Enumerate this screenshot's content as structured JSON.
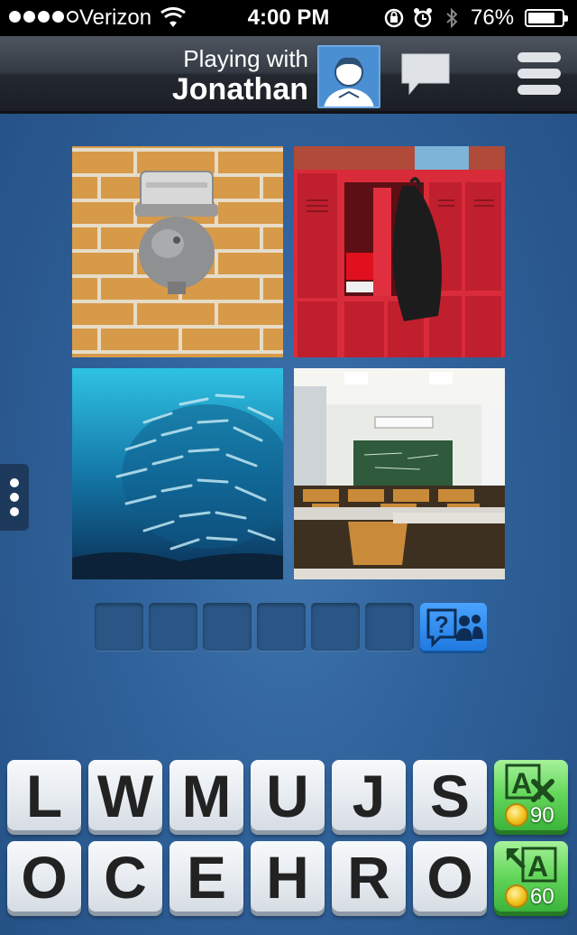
{
  "status_bar": {
    "carrier": "Verizon",
    "time": "4:00 PM",
    "battery_percent": "76%",
    "battery_level": 0.76,
    "signal_bars": 4,
    "icons": [
      "wifi-icon",
      "rotation-lock-icon",
      "alarm-icon",
      "bluetooth-icon",
      "battery-icon"
    ]
  },
  "header": {
    "playing_with_label": "Playing with",
    "opponent_name": "Jonathan",
    "avatar_icon": "user-avatar-icon",
    "chat_icon": "chat-bubble-icon",
    "menu_icon": "hamburger-menu-icon"
  },
  "puzzle": {
    "pictures": [
      "bell-on-brick-wall",
      "red-school-lockers-with-backpack",
      "school-of-fish-underwater",
      "classroom-with-desks"
    ],
    "answer_length": 6,
    "answer_letters": [
      "",
      "",
      "",
      "",
      "",
      ""
    ],
    "ask_friends_icon": "ask-friends-icon"
  },
  "letters": {
    "row1": [
      "L",
      "W",
      "M",
      "U",
      "J",
      "S"
    ],
    "row2": [
      "O",
      "C",
      "E",
      "H",
      "R",
      "O"
    ]
  },
  "powerups": {
    "remove_letters": {
      "icon": "remove-letters-icon",
      "cost": "90"
    },
    "reveal_letter": {
      "icon": "reveal-letter-icon",
      "cost": "60"
    }
  },
  "colors": {
    "background": "#2f619a",
    "tile": "#e6ebf0",
    "powerup": "#63d65a",
    "ask_button": "#2b8cf0",
    "lockers": "#d92b3a"
  }
}
